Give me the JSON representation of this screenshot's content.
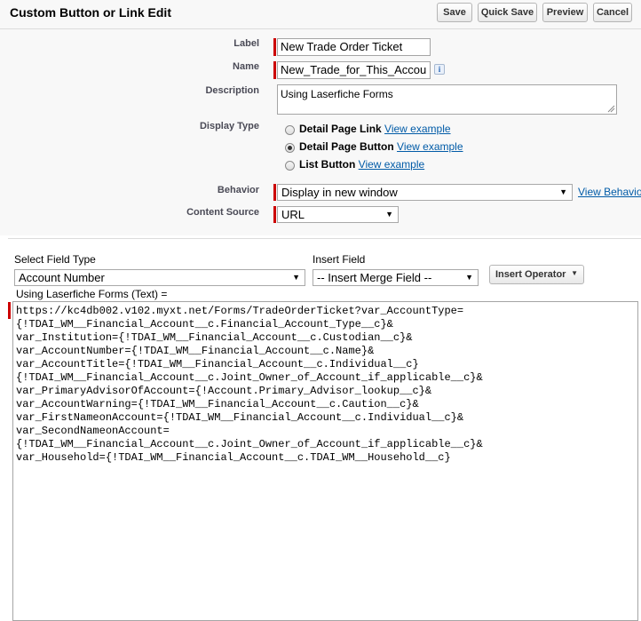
{
  "header": {
    "title": "Custom Button or Link Edit",
    "buttons": {
      "save": "Save",
      "quick_save": "Quick Save",
      "preview": "Preview",
      "cancel": "Cancel"
    }
  },
  "form": {
    "label": {
      "label": "Label",
      "value": "New Trade Order Ticket"
    },
    "name": {
      "label": "Name",
      "value": "New_Trade_for_This_Accou",
      "info_icon": "i"
    },
    "description": {
      "label": "Description",
      "value": "Using Laserfiche Forms"
    },
    "display_type": {
      "label": "Display Type",
      "options": [
        {
          "label": "Detail Page Link",
          "link": "View example",
          "selected": false
        },
        {
          "label": "Detail Page Button",
          "link": "View example",
          "selected": true
        },
        {
          "label": "List Button",
          "link": "View example",
          "selected": false
        }
      ]
    },
    "behavior": {
      "label": "Behavior",
      "value": "Display in new window",
      "link": "View Behavio"
    },
    "content_source": {
      "label": "Content Source",
      "value": "URL"
    }
  },
  "editor": {
    "field_type_label": "Select Field Type",
    "field_type_value": "Account Number",
    "insert_field_label": "Insert Field",
    "insert_field_value": "-- Insert Merge Field --",
    "insert_operator": "Insert Operator",
    "formula_label": "Using Laserfiche Forms (Text) =",
    "code": "https://kc4db002.v102.myxt.net/Forms/TradeOrderTicket?var_AccountType=\n{!TDAI_WM__Financial_Account__c.Financial_Account_Type__c}&\nvar_Institution={!TDAI_WM__Financial_Account__c.Custodian__c}&\nvar_AccountNumber={!TDAI_WM__Financial_Account__c.Name}&\nvar_AccountTitle={!TDAI_WM__Financial_Account__c.Individual__c}\n{!TDAI_WM__Financial_Account__c.Joint_Owner_of_Account_if_applicable__c}&\nvar_PrimaryAdvisorOfAccount={!Account.Primary_Advisor_lookup__c}&\nvar_AccountWarning={!TDAI_WM__Financial_Account__c.Caution__c}&\nvar_FirstNameonAccount={!TDAI_WM__Financial_Account__c.Individual__c}&\nvar_SecondNameonAccount=\n{!TDAI_WM__Financial_Account__c.Joint_Owner_of_Account_if_applicable__c}&\nvar_Household={!TDAI_WM__Financial_Account__c.TDAI_WM__Household__c}"
  },
  "icons": {
    "dropdown": "chevron-down-icon",
    "info": "info-icon"
  }
}
